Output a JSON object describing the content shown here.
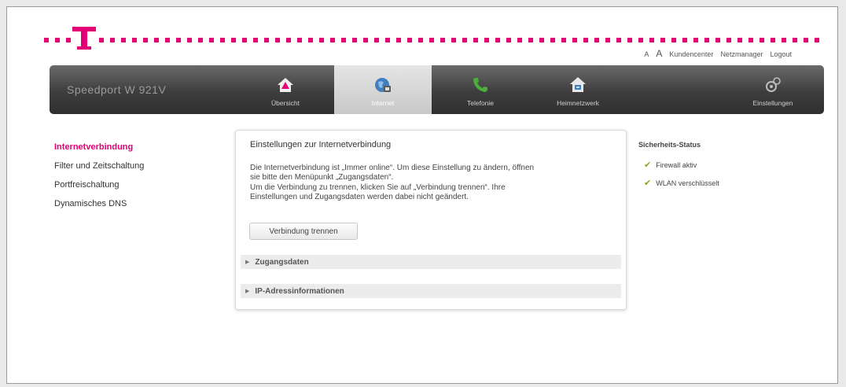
{
  "brand": {
    "product": "Speedport W 921V",
    "accent": "#e20074"
  },
  "toplinks": {
    "font_small": "A",
    "font_large": "A",
    "customer_center": "Kundencenter",
    "network_manager": "Netzmanager",
    "logout": "Logout"
  },
  "nav": {
    "items": [
      {
        "label": "Übersicht",
        "icon": "house-warning-icon",
        "active": false
      },
      {
        "label": "Internet",
        "icon": "globe-icon",
        "active": true
      },
      {
        "label": "Telefonie",
        "icon": "phone-icon",
        "active": false
      },
      {
        "label": "Heimnetzwerk",
        "icon": "home-network-icon",
        "active": false
      }
    ],
    "settings": {
      "label": "Einstellungen",
      "icon": "gear-icon"
    }
  },
  "sidebar": {
    "items": [
      {
        "label": "Internetverbindung",
        "active": true
      },
      {
        "label": "Filter und Zeitschaltung",
        "active": false
      },
      {
        "label": "Portfreischaltung",
        "active": false
      },
      {
        "label": "Dynamisches DNS",
        "active": false
      }
    ]
  },
  "main": {
    "title": "Einstellungen zur Internetverbindung",
    "para1_line1": "Die Internetverbindung ist „Immer online“. Um diese Einstellung zu ändern, öffnen",
    "para1_line2": "sie bitte den Menüpunkt „Zugangsdaten“.",
    "para2_line1": "Um die Verbindung zu trennen, klicken Sie auf „Verbindung trennen“. Ihre",
    "para2_line2": "Einstellungen und Zugangsdaten werden dabei nicht geändert.",
    "disconnect_button": "Verbindung trennen",
    "sections": [
      {
        "label": "Zugangsdaten"
      },
      {
        "label": "IP-Adressinformationen"
      }
    ]
  },
  "security": {
    "title": "Sicherheits-Status",
    "items": [
      {
        "label": "Firewall aktiv"
      },
      {
        "label": "WLAN verschlüsselt"
      }
    ],
    "ok_color": "#8aa61f"
  }
}
